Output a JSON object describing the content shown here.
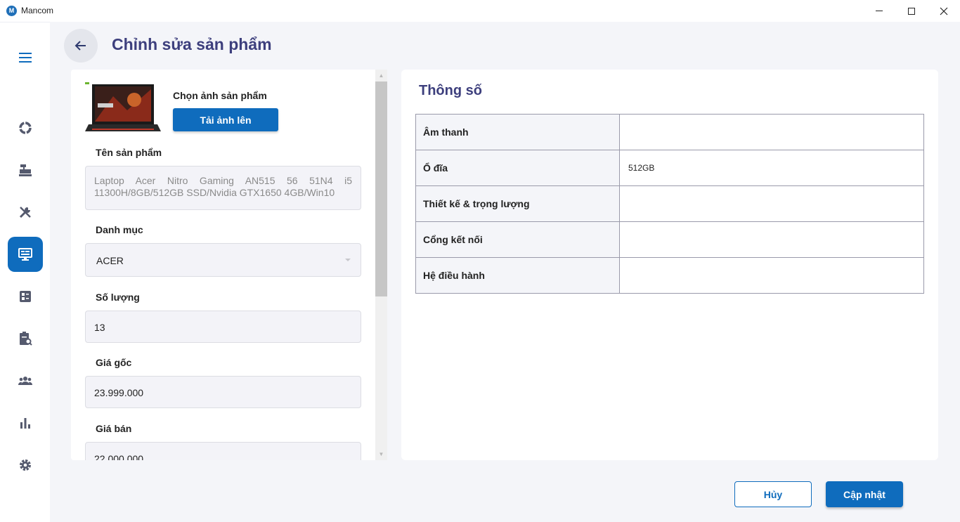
{
  "window": {
    "title": "Mancom",
    "logo_letter": "M"
  },
  "sidebar": {
    "items": [
      {
        "icon": "menu-icon"
      },
      {
        "icon": "dashboard-icon"
      },
      {
        "icon": "cash-register-icon"
      },
      {
        "icon": "tools-icon"
      },
      {
        "icon": "product-monitor-icon",
        "active": true
      },
      {
        "icon": "category-list-icon"
      },
      {
        "icon": "inventory-search-icon"
      },
      {
        "icon": "customers-icon"
      },
      {
        "icon": "statistics-icon"
      },
      {
        "icon": "settings-icon"
      }
    ],
    "active_color": "#0f6cbd"
  },
  "header": {
    "title": "Chỉnh sửa sản phẩm"
  },
  "form": {
    "image_label": "Chọn ảnh sản phẩm",
    "upload_button": "Tải ảnh lên",
    "image_brand": "acer",
    "image_model": "NITRO",
    "name_label": "Tên sản phẩm",
    "name_value": "Laptop Acer Nitro Gaming AN515 56 51N4 i5 11300H/8GB/512GB SSD/Nvidia GTX1650 4GB/Win10",
    "category_label": "Danh mục",
    "category_value": "ACER",
    "quantity_label": "Số lượng",
    "quantity_value": "13",
    "original_price_label": "Giá gốc",
    "original_price_value": "23.999.000",
    "sale_price_label": "Giá bán",
    "sale_price_value": "22.000.000"
  },
  "specs": {
    "title": "Thông số",
    "rows": [
      {
        "key": "Âm thanh",
        "value": ""
      },
      {
        "key": "Ổ đĩa",
        "value": "512GB"
      },
      {
        "key": "Thiết kế & trọng lượng",
        "value": ""
      },
      {
        "key": "Cổng kết nối",
        "value": ""
      },
      {
        "key": "Hệ điều hành",
        "value": ""
      }
    ]
  },
  "footer": {
    "cancel_label": "Hủy",
    "update_label": "Cập nhật"
  },
  "colors": {
    "accent": "#0f6cbd",
    "title": "#3d3f7d",
    "background": "#f4f5f9"
  }
}
